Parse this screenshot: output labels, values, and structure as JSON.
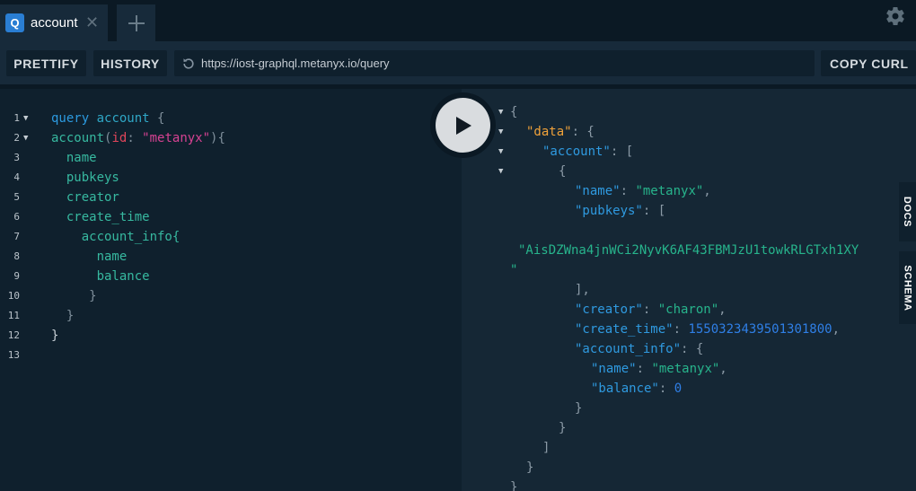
{
  "tabs": {
    "active": {
      "badge": "Q",
      "title": "account",
      "close": "✕"
    },
    "add_icon": "plus-icon"
  },
  "toolbar": {
    "prettify": "PRETTIFY",
    "history": "HISTORY",
    "url": "https://iost-graphql.metanyx.io/query",
    "copy_curl": "COPY CURL"
  },
  "query": {
    "line_numbers": [
      "1",
      "2",
      "3",
      "4",
      "5",
      "6",
      "7",
      "8",
      "9",
      "10",
      "11",
      "12",
      "13"
    ],
    "line1": {
      "kw": "query",
      "name": "account",
      "brace": "{"
    },
    "line2": {
      "field": "account",
      "p1": "(",
      "arg": "id",
      "colon": ": ",
      "str": "\"metanyx\"",
      "p2": "){"
    },
    "fields": [
      "name",
      "pubkeys",
      "creator",
      "create_time"
    ],
    "sub_field": "account_info{",
    "sub_fields": [
      "name",
      "balance"
    ],
    "close": "}"
  },
  "result": {
    "open": "{",
    "data_key": "\"data\"",
    "account_key": "\"account\"",
    "name_key": "\"name\"",
    "name_val": "\"metanyx\"",
    "pubkeys_key": "\"pubkeys\"",
    "pubkey_val": "\"AisDZWna4jnWCi2NyvK6AF43FBMJzU1towkRLGTxh1XY",
    "pubkey_wrap": "\"",
    "close_arr_comma": "],",
    "creator_key": "\"creator\"",
    "creator_val": "\"charon\"",
    "create_time_key": "\"create_time\"",
    "create_time_val": "1550323439501301800",
    "account_info_key": "\"account_info\"",
    "ai_name_key": "\"name\"",
    "ai_name_val": "\"metanyx\"",
    "balance_key": "\"balance\"",
    "balance_val": "0",
    "colon": ": ",
    "colon_brace": ": {",
    "colon_bracket": ": [",
    "comma": ",",
    "brace_close": "}",
    "bracket_close": "]",
    "open_brace": "{"
  },
  "side_tabs": {
    "docs": "DOCS",
    "schema": "SCHEMA"
  }
}
